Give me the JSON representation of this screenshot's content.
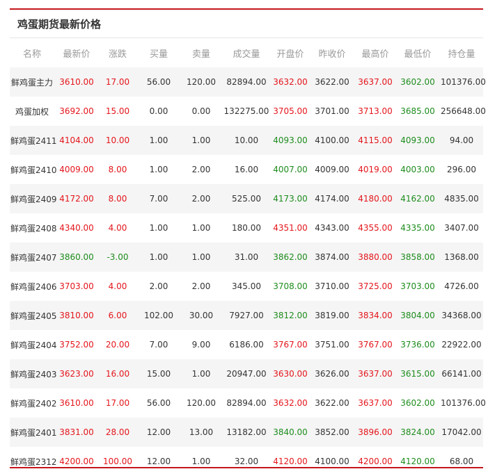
{
  "panel": {
    "title": "鸡蛋期货最新价格"
  },
  "columns": [
    "名称",
    "最新价",
    "涨跌",
    "买量",
    "卖量",
    "成交量",
    "开盘价",
    "昨收价",
    "最高价",
    "最低价",
    "持仓量"
  ],
  "colors": {
    "up": "#e4151b",
    "down": "#1d8c1d",
    "accent": "#c4161c"
  },
  "rows": [
    [
      "鲜鸡蛋主力",
      "3610.00",
      "17.00",
      "56.00",
      "120.00",
      "82894.00",
      "3632.00",
      "3622.00",
      "3637.00",
      "3602.00",
      "101376.00"
    ],
    [
      "鸡蛋加权",
      "3692.00",
      "15.00",
      "0.00",
      "0.00",
      "132275.00",
      "3705.00",
      "3701.00",
      "3713.00",
      "3685.00",
      "256648.00"
    ],
    [
      "鲜鸡蛋2411",
      "4104.00",
      "10.00",
      "1.00",
      "1.00",
      "10.00",
      "4093.00",
      "4100.00",
      "4115.00",
      "4093.00",
      "94.00"
    ],
    [
      "鲜鸡蛋2410",
      "4009.00",
      "8.00",
      "1.00",
      "2.00",
      "16.00",
      "4007.00",
      "4009.00",
      "4019.00",
      "4003.00",
      "296.00"
    ],
    [
      "鲜鸡蛋2409",
      "4172.00",
      "8.00",
      "7.00",
      "2.00",
      "525.00",
      "4173.00",
      "4174.00",
      "4180.00",
      "4162.00",
      "4835.00"
    ],
    [
      "鲜鸡蛋2408",
      "4340.00",
      "4.00",
      "1.00",
      "1.00",
      "180.00",
      "4351.00",
      "4343.00",
      "4355.00",
      "4335.00",
      "3407.00"
    ],
    [
      "鲜鸡蛋2407",
      "3860.00",
      "-3.00",
      "1.00",
      "1.00",
      "31.00",
      "3862.00",
      "3874.00",
      "3880.00",
      "3858.00",
      "1368.00"
    ],
    [
      "鲜鸡蛋2406",
      "3703.00",
      "4.00",
      "2.00",
      "2.00",
      "345.00",
      "3708.00",
      "3710.00",
      "3725.00",
      "3703.00",
      "4726.00"
    ],
    [
      "鲜鸡蛋2405",
      "3810.00",
      "6.00",
      "102.00",
      "30.00",
      "7927.00",
      "3812.00",
      "3819.00",
      "3834.00",
      "3804.00",
      "34368.00"
    ],
    [
      "鲜鸡蛋2404",
      "3752.00",
      "20.00",
      "7.00",
      "9.00",
      "6186.00",
      "3767.00",
      "3751.00",
      "3767.00",
      "3736.00",
      "22922.00"
    ],
    [
      "鲜鸡蛋2403",
      "3623.00",
      "16.00",
      "15.00",
      "1.00",
      "20947.00",
      "3630.00",
      "3626.00",
      "3637.00",
      "3615.00",
      "66141.00"
    ],
    [
      "鲜鸡蛋2402",
      "3610.00",
      "17.00",
      "56.00",
      "120.00",
      "82894.00",
      "3632.00",
      "3622.00",
      "3637.00",
      "3602.00",
      "101376.00"
    ],
    [
      "鲜鸡蛋2401",
      "3831.00",
      "28.00",
      "12.00",
      "13.00",
      "13182.00",
      "3840.00",
      "3852.00",
      "3896.00",
      "3824.00",
      "17042.00"
    ],
    [
      "鲜鸡蛋2312",
      "4200.00",
      "100.00",
      "12.00",
      "1.00",
      "32.00",
      "4120.00",
      "4100.00",
      "4200.00",
      "4120.00",
      "68.00"
    ]
  ],
  "cell_colors": [
    [
      "",
      "up",
      "up",
      "",
      "",
      "",
      "up",
      "",
      "up",
      "down",
      ""
    ],
    [
      "",
      "up",
      "up",
      "",
      "",
      "",
      "up",
      "",
      "up",
      "down",
      ""
    ],
    [
      "",
      "up",
      "up",
      "",
      "",
      "",
      "down",
      "",
      "up",
      "down",
      ""
    ],
    [
      "",
      "up",
      "up",
      "",
      "",
      "",
      "down",
      "",
      "up",
      "down",
      ""
    ],
    [
      "",
      "up",
      "up",
      "",
      "",
      "",
      "down",
      "",
      "up",
      "down",
      ""
    ],
    [
      "",
      "up",
      "up",
      "",
      "",
      "",
      "up",
      "",
      "up",
      "down",
      ""
    ],
    [
      "",
      "down",
      "down",
      "",
      "",
      "",
      "down",
      "",
      "up",
      "down",
      ""
    ],
    [
      "",
      "up",
      "up",
      "",
      "",
      "",
      "down",
      "",
      "up",
      "down",
      ""
    ],
    [
      "",
      "up",
      "up",
      "",
      "",
      "",
      "down",
      "",
      "up",
      "down",
      ""
    ],
    [
      "",
      "up",
      "up",
      "",
      "",
      "",
      "up",
      "",
      "up",
      "down",
      ""
    ],
    [
      "",
      "up",
      "up",
      "",
      "",
      "",
      "up",
      "",
      "up",
      "down",
      ""
    ],
    [
      "",
      "up",
      "up",
      "",
      "",
      "",
      "up",
      "",
      "up",
      "down",
      ""
    ],
    [
      "",
      "up",
      "up",
      "",
      "",
      "",
      "down",
      "",
      "up",
      "down",
      ""
    ],
    [
      "",
      "up",
      "up",
      "",
      "",
      "",
      "up",
      "",
      "up",
      "down",
      ""
    ]
  ]
}
